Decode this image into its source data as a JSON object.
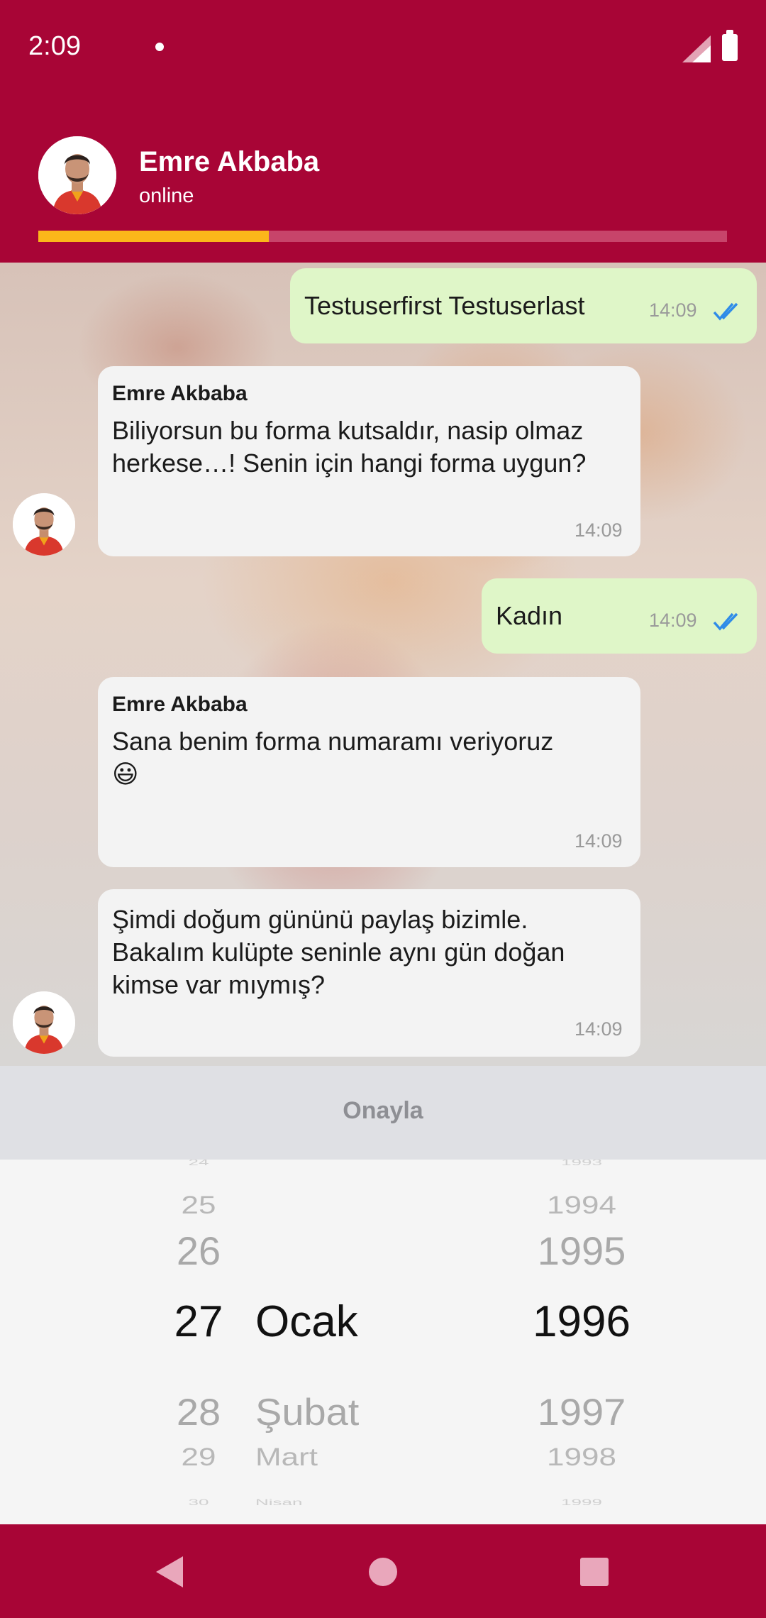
{
  "status_bar": {
    "time": "2:09"
  },
  "header": {
    "contact_name": "Emre Akbaba",
    "contact_status": "online",
    "progress_percent": 33.5
  },
  "messages": [
    {
      "direction": "out",
      "text": "Testuserfirst Testuserlast",
      "time": "14:09"
    },
    {
      "direction": "in",
      "sender": "Emre Akbaba",
      "text_line1": "Biliyorsun bu forma kutsaldır, nasip olmaz",
      "text_line2": "herkese…! Senin için hangi forma uygun?",
      "time": "14:09"
    },
    {
      "direction": "out",
      "text": "Kadın",
      "time": "14:09"
    },
    {
      "direction": "in",
      "sender": "Emre Akbaba",
      "text": "Sana benim forma numaramı veriyoruz",
      "emoji": "😃",
      "time": "14:09"
    },
    {
      "direction": "in",
      "text_line1": "Şimdi doğum gününü paylaş bizimle.",
      "text_line2": "Bakalım kulüpte seninle aynı gün doğan",
      "text_line3": "kimse var mıymış?",
      "time": "14:09"
    }
  ],
  "confirm_label": "Onayla",
  "date_picker": {
    "days": [
      "24",
      "25",
      "26",
      "27",
      "28",
      "29",
      "30"
    ],
    "months": [
      "Ocak",
      "Şubat",
      "Mart",
      "Nisan"
    ],
    "years": [
      "1993",
      "1994",
      "1995",
      "1996",
      "1997",
      "1998",
      "1999"
    ],
    "selected": {
      "day": "27",
      "month": "Ocak",
      "year": "1996"
    }
  },
  "colors": {
    "brand": "#a80536",
    "progress": "#fbb71a",
    "outgoing_bubble": "#dff6c8",
    "incoming_bubble": "#f3f3f3",
    "read_ticks": "#2f8ce8"
  },
  "icons": [
    "avatar",
    "double-check-icon",
    "back-icon",
    "home-icon",
    "recents-icon"
  ]
}
